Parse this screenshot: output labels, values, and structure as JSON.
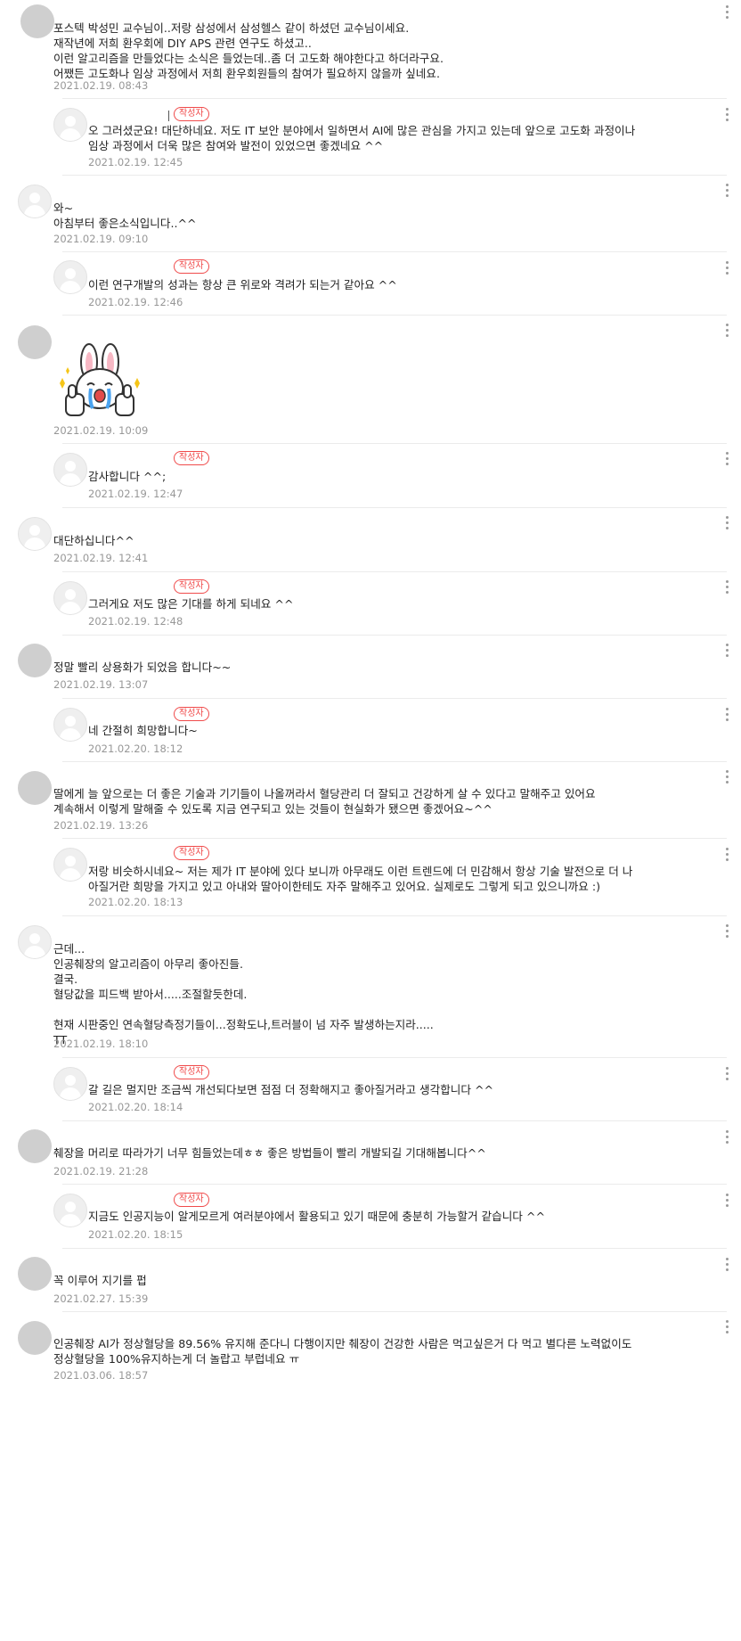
{
  "author_badge": "작성자",
  "comments": [
    {
      "text": "포스텍 박성민 교수님이..저랑 삼성에서 삼성헬스 같이 하셨던 교수님이세요.\n재작년에 저희 환우회에 DIY APS 관련 연구도 하셨고..\n이런 알고리즘을 만들었다는 소식은 들었는데..좀 더 고도화 해야한다고 하더라구요.\n어쨌든 고도화나 임상 과정에서 저희 환우회원들의 참여가 필요하지 않을까 싶네요.",
      "date": "2021.02.19. 08:43"
    },
    {
      "text": "오 그러셨군요! 대단하네요. 저도 IT 보안 분야에서 일하면서 AI에 많은 관심을 가지고 있는데 앞으로 고도화 과정이나\n임상 과정에서 더욱 많은 참여와 발전이 있었으면 좋겠네요 ^^",
      "date": "2021.02.19. 12:45"
    },
    {
      "text": "와~\n아침부터 좋은소식입니다..^^",
      "date": "2021.02.19. 09:10"
    },
    {
      "text": "이런 연구개발의 성과는 항상 큰 위로와 격려가 되는거 같아요 ^^",
      "date": "2021.02.19. 12:46"
    },
    {
      "text": "",
      "date": "2021.02.19. 10:09"
    },
    {
      "text": "감사합니다 ^^;",
      "date": "2021.02.19. 12:47"
    },
    {
      "text": "대단하십니다^^",
      "date": "2021.02.19. 12:41"
    },
    {
      "text": "그러게요 저도 많은 기대를 하게 되네요 ^^",
      "date": "2021.02.19. 12:48"
    },
    {
      "text": "정말 빨리 상용화가 되었음 합니다~~",
      "date": "2021.02.19. 13:07"
    },
    {
      "text": "네 간절히 희망합니다~",
      "date": "2021.02.20. 18:12"
    },
    {
      "text": "딸에게 늘 앞으로는 더 좋은 기술과 기기들이 나올꺼라서 혈당관리 더 잘되고 건강하게 살 수 있다고 말해주고 있어요\n계속해서 이렇게 말해줄 수 있도록 지금 연구되고 있는 것들이 현실화가 됐으면 좋겠어요~^^",
      "date": "2021.02.19. 13:26"
    },
    {
      "text": "저랑 비슷하시네요~ 저는 제가 IT 분야에 있다 보니까 아무래도 이런 트렌드에 더 민감해서 항상 기술 발전으로 더 나\n아질거란 희망을 가지고 있고 아내와 딸아이한테도 자주 말해주고 있어요. 실제로도 그렇게 되고 있으니까요 :)",
      "date": "2021.02.20. 18:13"
    },
    {
      "text": "근데...\n인공췌장의 알고리즘이 아무리 좋아진들.\n결국.\n혈당값을 피드백 받아서.....조절할듯한데.\n\n현재 시판중인 연속혈당측정기들이...정확도나,트러블이 넘 자주 발생하는지라.....\nTT",
      "date": "2021.02.19. 18:10"
    },
    {
      "text": "갈 길은 멀지만 조금씩 개선되다보면 점점 더 정확해지고 좋아질거라고 생각합니다 ^^",
      "date": "2021.02.20. 18:14"
    },
    {
      "text": "췌장을 머리로 따라가기 너무 힘들었는데ㅎㅎ 좋은 방법들이 빨리 개발되길 기대해봅니다^^",
      "date": "2021.02.19. 21:28"
    },
    {
      "text": "지금도 인공지능이 알게모르게 여러분야에서 활용되고 있기 때문에 충분히 가능할거 같습니다 ^^",
      "date": "2021.02.20. 18:15"
    },
    {
      "text": "꼭 이루어 지기를 펍",
      "date": "2021.02.27. 15:39"
    },
    {
      "text": "인공췌장 AI가 정상혈당을 89.56% 유지해 준다니 다행이지만 췌장이 건강한 사람은 먹고싶은거 다 먹고 별다른 노력없이도\n정상혈당을 100%유지하는게 더 놀랍고 부럽네요 ㅠ",
      "date": "2021.03.06. 18:57"
    }
  ]
}
